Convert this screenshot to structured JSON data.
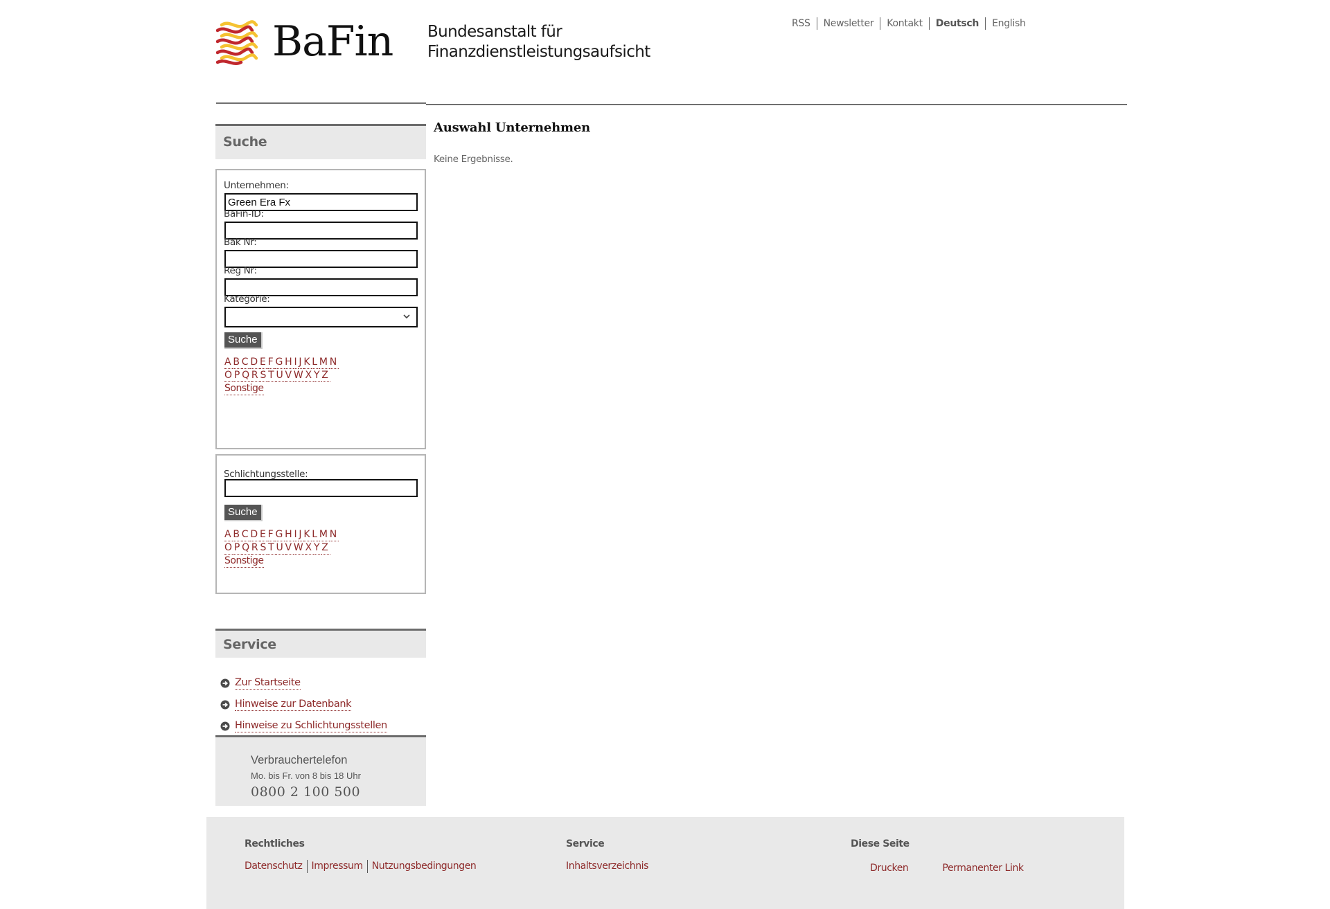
{
  "header": {
    "logo_text": "BaFin",
    "logo_subtitle_line1": "Bundesanstalt für",
    "logo_subtitle_line2": "Finanzdienstleistungsaufsicht",
    "logo_colors": {
      "red": "#c0272d",
      "yellow": "#f5c232"
    },
    "nav": [
      {
        "label": "RSS",
        "active": false
      },
      {
        "label": "Newsletter",
        "active": false
      },
      {
        "label": "Kontakt",
        "active": false
      },
      {
        "label": "Deutsch",
        "active": true
      },
      {
        "label": "English",
        "active": false
      }
    ]
  },
  "sidebar": {
    "search_title": "Suche",
    "company_form": {
      "fields": [
        {
          "label": "Unternehmen:",
          "value": "Green Era Fx"
        },
        {
          "label": "BaFin-ID:",
          "value": ""
        },
        {
          "label": "Bak Nr:",
          "value": ""
        },
        {
          "label": "Reg Nr:",
          "value": ""
        }
      ],
      "category_label": "Kategorie:",
      "category_value": "",
      "submit_label": "Suche"
    },
    "arbitration_form": {
      "label": "Schlichtungsstelle:",
      "value": "",
      "submit_label": "Suche"
    },
    "alphabet_row1": [
      "A",
      "B",
      "C",
      "D",
      "E",
      "F",
      "G",
      "H",
      "I",
      "J",
      "K",
      "L",
      "M",
      "N"
    ],
    "alphabet_row2": [
      "O",
      "P",
      "Q",
      "R",
      "S",
      "T",
      "U",
      "V",
      "W",
      "X",
      "Y",
      "Z"
    ],
    "alphabet_other": "Sonstige",
    "service_title": "Service",
    "service_links": [
      {
        "label": "Zur Startseite",
        "icon": "arrow-circle-right-icon"
      },
      {
        "label": "Hinweise zur Datenbank",
        "icon": "arrow-circle-right-icon"
      },
      {
        "label": "Hinweise zu Schlichtungsstellen",
        "icon": "arrow-circle-right-icon"
      }
    ],
    "phone": {
      "title": "Verbrauchertelefon",
      "hours": "Mo. bis Fr. von 8 bis 18 Uhr",
      "number": "0800 2 100 500"
    }
  },
  "main": {
    "title": "Auswahl Unternehmen",
    "empty_message": "Keine Ergebnisse."
  },
  "footer": {
    "columns": [
      {
        "title": "Rechtliches",
        "links": [
          "Datenschutz",
          "Impressum",
          "Nutzungsbedingungen"
        ]
      },
      {
        "title": "Service",
        "links": [
          "Inhaltsverzeichnis"
        ]
      },
      {
        "title": "Diese Seite",
        "links": [
          "Drucken",
          "Permanenter Link"
        ]
      }
    ]
  },
  "colors": {
    "link": "#8e2b2b",
    "panel_bg": "#e9e9e9",
    "button_bg": "#555555"
  }
}
